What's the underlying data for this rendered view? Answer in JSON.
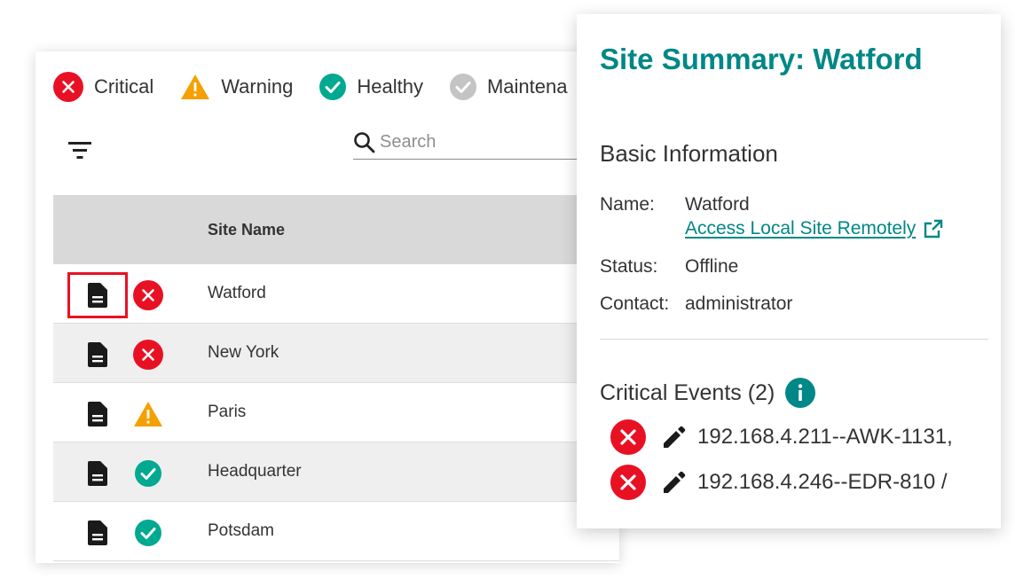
{
  "legend": [
    {
      "label": "Critical",
      "status": "critical"
    },
    {
      "label": "Warning",
      "status": "warning"
    },
    {
      "label": "Healthy",
      "status": "healthy"
    },
    {
      "label": "Maintena",
      "status": "maintenance"
    }
  ],
  "search": {
    "placeholder": "Search",
    "value": ""
  },
  "table": {
    "columns": [
      "",
      "",
      "Site Name"
    ],
    "rows": [
      {
        "name": "Watford",
        "status": "critical",
        "selected": true
      },
      {
        "name": "New York",
        "status": "critical",
        "selected": false
      },
      {
        "name": "Paris",
        "status": "warning",
        "selected": false
      },
      {
        "name": "Headquarter",
        "status": "healthy",
        "selected": false
      },
      {
        "name": "Potsdam",
        "status": "healthy",
        "selected": false
      }
    ]
  },
  "summary": {
    "title": "Site Summary: Watford",
    "basic_info_title": "Basic Information",
    "name_label": "Name:",
    "name_value": "Watford",
    "remote_link": "Access Local Site Remotely",
    "status_label": "Status:",
    "status_value": "Offline",
    "contact_label": "Contact:",
    "contact_value": "administrator",
    "critical_events_title": "Critical Events (2)",
    "events": [
      {
        "text": "192.168.4.211--AWK-1131,"
      },
      {
        "text": "192.168.4.246--EDR-810 /"
      }
    ]
  },
  "colors": {
    "critical": "#e81123",
    "warning": "#f5a000",
    "healthy": "#00a98f",
    "maintenance": "#c4c4c4",
    "accent": "#008787",
    "header_bg": "#d9d9d9",
    "row_alt": "#efefef"
  },
  "icons": {
    "critical": "x-circle-icon",
    "warning": "warning-triangle-icon",
    "healthy": "check-circle-icon",
    "maintenance": "check-circle-icon",
    "filter": "filter-icon",
    "search": "search-icon",
    "document": "document-icon",
    "external_link": "external-link-icon",
    "info": "info-icon",
    "edit": "pencil-icon"
  }
}
